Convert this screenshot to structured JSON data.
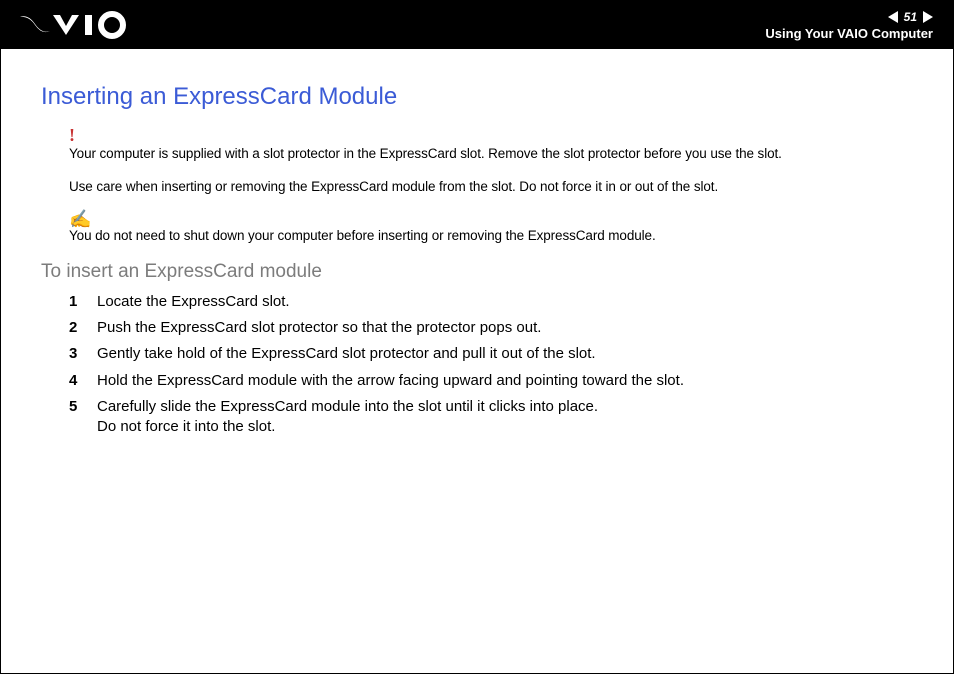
{
  "header": {
    "page_number": "51",
    "section": "Using Your VAIO Computer"
  },
  "page": {
    "title": "Inserting an ExpressCard Module",
    "caution_1": "Your computer is supplied with a slot protector in the ExpressCard slot. Remove the slot protector before you use the slot.",
    "caution_2": "Use care when inserting or removing the ExpressCard module from the slot. Do not force it in or out of the slot.",
    "tip": "You do not need to shut down your computer before inserting or removing the ExpressCard module.",
    "subhead": "To insert an ExpressCard module",
    "steps": [
      {
        "text": "Locate the ExpressCard slot."
      },
      {
        "text": "Push the ExpressCard slot protector so that the protector pops out."
      },
      {
        "text": "Gently take hold of the ExpressCard slot protector and pull it out of the slot."
      },
      {
        "text": "Hold the ExpressCard module with the arrow facing upward and pointing toward the slot."
      },
      {
        "text": "Carefully slide the ExpressCard module into the slot until it clicks into place.",
        "extra": "Do not force it into the slot."
      }
    ]
  }
}
